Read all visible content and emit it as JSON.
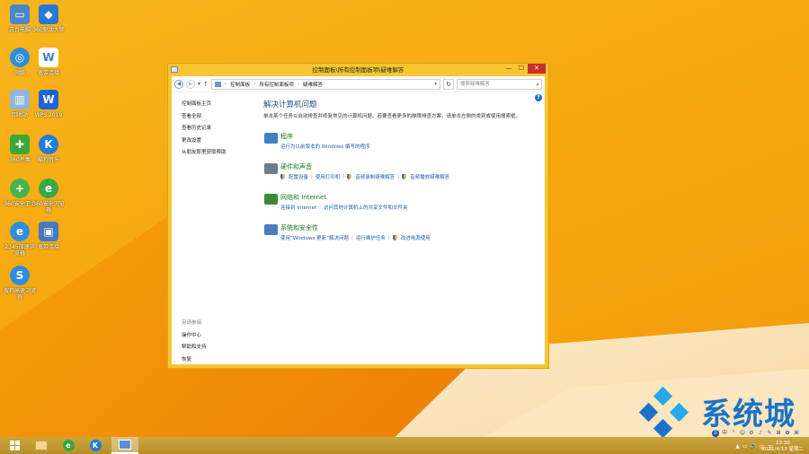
{
  "desktop": {
    "icons": [
      {
        "label": "这台电脑",
        "icon": "computer-icon",
        "color": "#4a86c8"
      },
      {
        "label": "360驱动大师",
        "icon": "driver-master-icon",
        "color": "#2a78d6"
      },
      {
        "label": "网络",
        "icon": "network-icon",
        "color": "#2f8fd8"
      },
      {
        "label": "宽带连接",
        "icon": "broadband-icon",
        "color": "#3b7ed0"
      },
      {
        "label": "回收站",
        "icon": "recycle-bin-icon",
        "color": "#8fb6de"
      },
      {
        "label": "WPS 2019",
        "icon": "wps-icon",
        "color": "#1d64d8"
      },
      {
        "label": "360杀毒",
        "icon": "antivirus-icon",
        "color": "#3aa83a"
      },
      {
        "label": "酷狗音乐",
        "icon": "kugou-icon",
        "color": "#1f7ce0"
      },
      {
        "label": "360安全卫士",
        "icon": "security-guard-icon",
        "color": "#47b54a"
      },
      {
        "label": "360安全浏览器",
        "icon": "secure-browser-icon",
        "color": "#37a945"
      },
      {
        "label": "2345加速浏览器",
        "icon": "ie-browser-icon",
        "color": "#2e8fe0"
      },
      {
        "label": "宽带连接",
        "icon": "dialup-icon",
        "color": "#4579c0"
      },
      {
        "label": "搜狗高速浏览器",
        "icon": "sogou-browser-icon",
        "color": "#2f8de0"
      }
    ]
  },
  "window": {
    "title": "控制面板\\所有控制面板项\\疑难解答",
    "minimize": "—",
    "maximize": "☐",
    "close": "✕",
    "breadcrumb": [
      "控制面板",
      "所有控制面板项",
      "疑难解答"
    ],
    "search_placeholder": "搜索疑难解答",
    "left_nav": [
      "控制面板主页",
      "查看全部",
      "查看历史记录",
      "更改设置",
      "从朋友那里获取帮助"
    ],
    "see_also": {
      "header": "另请参阅",
      "items": [
        "操作中心",
        "帮助和支持",
        "恢复"
      ]
    },
    "main": {
      "heading": "解决计算机问题",
      "description": "单击某个任务以自动排查并修复常见的计算机问题。若要查看更多的故障排查方案，请单击左侧的类别或使用搜索框。",
      "categories": [
        {
          "title": "程序",
          "links": [
            "运行为以前版本的 Windows 编写的程序"
          ],
          "shields": [
            false
          ],
          "color": "#3f7fc8"
        },
        {
          "title": "硬件和声音",
          "links": [
            "配置设备",
            "使用打印机",
            "音频录制疑难解答",
            "音频播放疑难解答"
          ],
          "shields": [
            true,
            false,
            true,
            true
          ],
          "color": "#6b7e8e"
        },
        {
          "title": "网络和 Internet",
          "links": [
            "连接到 Internet",
            "访问其他计算机上的共享文件和文件夹"
          ],
          "shields": [
            false,
            false
          ],
          "color": "#3b8a3b"
        },
        {
          "title": "系统和安全性",
          "links": [
            "使用“Windows 更新”解决问题",
            "运行维护任务",
            "改进电源使用"
          ],
          "shields": [
            false,
            false,
            true
          ],
          "color": "#4a7cc0"
        }
      ]
    }
  },
  "taskbar": {
    "items": [
      "start",
      "file-explorer",
      "360-browser",
      "kugou",
      "control-panel"
    ],
    "tray_icons": [
      "中",
      "°",
      "☺",
      "⚙",
      "♪",
      "✎",
      "⊞",
      "✿",
      "⌘"
    ],
    "ime_label": "王",
    "tray_status": [
      "▲",
      "▭",
      "🔊",
      "中",
      "王"
    ],
    "time": "13:30",
    "date": "2021/4/13 星期二"
  },
  "watermark": {
    "text": "系统城"
  }
}
